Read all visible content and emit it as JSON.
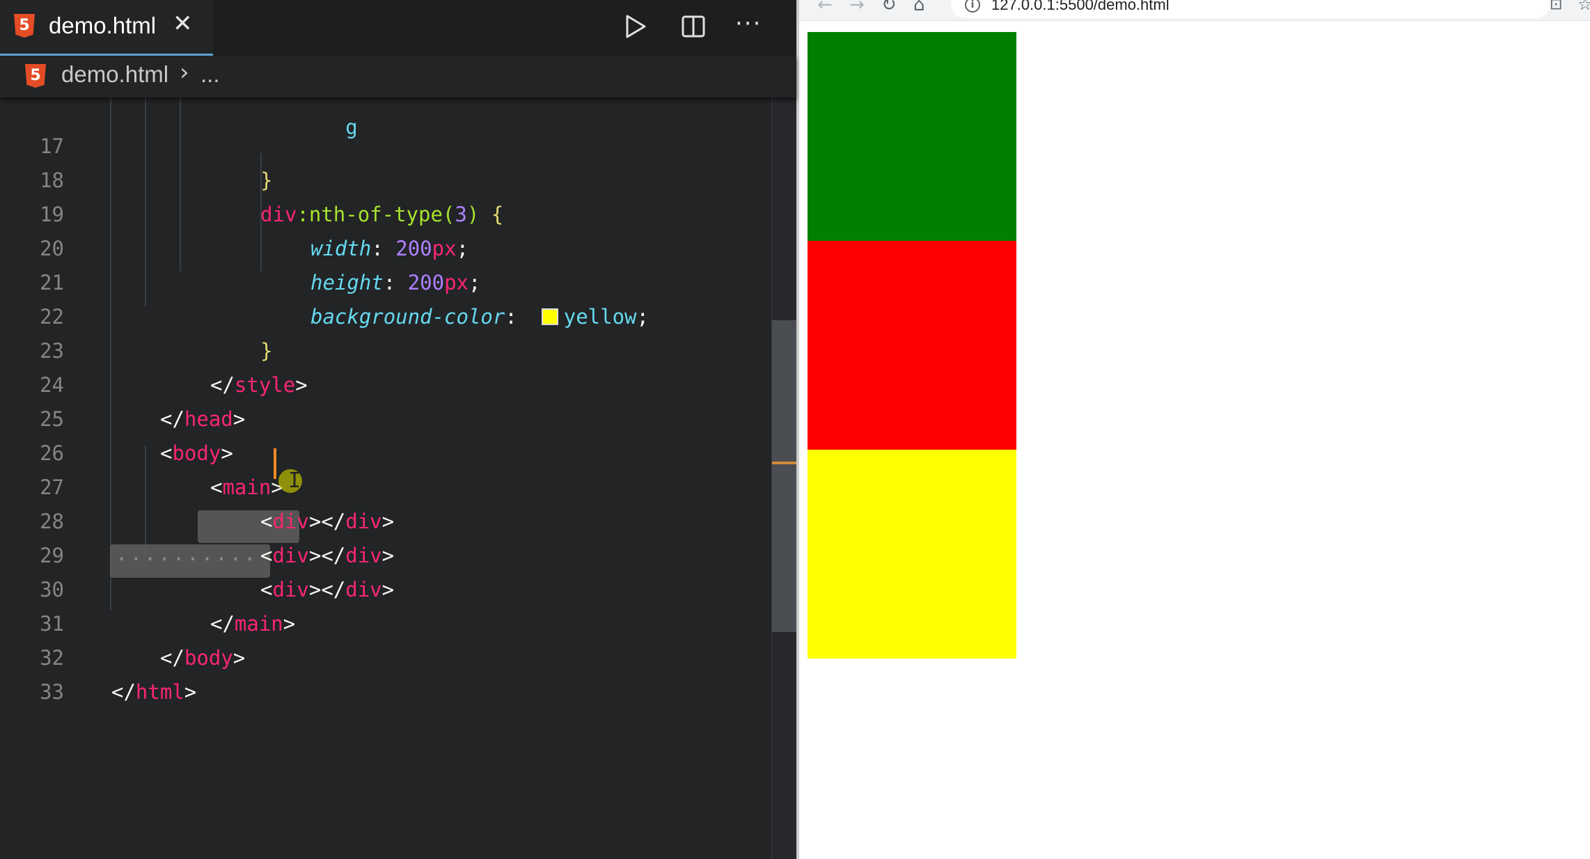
{
  "editor": {
    "tab": {
      "label": "demo.html",
      "close": "✕"
    },
    "breadcrumb": {
      "file": "demo.html",
      "separator": "›",
      "more": "..."
    },
    "lines": [
      {
        "n": "17",
        "text": "}"
      },
      {
        "n": "18",
        "text": "div:nth-of-type(3) {"
      },
      {
        "n": "19",
        "text": "width: 200px;"
      },
      {
        "n": "20",
        "text": "height: 200px;"
      },
      {
        "n": "21",
        "text": "background-color: yellow;"
      },
      {
        "n": "22",
        "text": "}"
      },
      {
        "n": "23",
        "text": "</style>"
      },
      {
        "n": "24",
        "text": "</head>"
      },
      {
        "n": "25",
        "text": "<body>"
      },
      {
        "n": "26",
        "text": "<main>"
      },
      {
        "n": "27",
        "text": "<div></div>"
      },
      {
        "n": "28",
        "text": "<div></div>"
      },
      {
        "n": "29",
        "text": "<div></div>"
      },
      {
        "n": "30",
        "text": "</main>"
      },
      {
        "n": "31",
        "text": "</body>"
      },
      {
        "n": "32",
        "text": "</html>"
      },
      {
        "n": "33",
        "text": ""
      }
    ],
    "tokens": {
      "div": "div",
      "nth": ":nth-of-type(",
      "three": "3",
      "close_paren": ")",
      "open_brace": "{",
      "width": "width",
      "height": "height",
      "bg": "background-color",
      "colon": ":",
      "num200": "200",
      "px": "px",
      "semi": ";",
      "yellow": "yellow",
      "close_brace": "}",
      "lt": "<",
      "lts": "</",
      "gt": ">",
      "style": "style",
      "head": "head",
      "body": "body",
      "main": "main",
      "html": "html"
    },
    "swatch_color": "#ffff00"
  },
  "browser": {
    "url": "127.0.0.1:5500/demo.html",
    "info": "i",
    "icons": {
      "back": "←",
      "forward": "→",
      "reload": "↻",
      "home": "⌂",
      "star": "☆",
      "translate": "⊡"
    },
    "boxes": [
      {
        "color": "#008000"
      },
      {
        "color": "#ff0000"
      },
      {
        "color": "#ffff00"
      }
    ]
  }
}
